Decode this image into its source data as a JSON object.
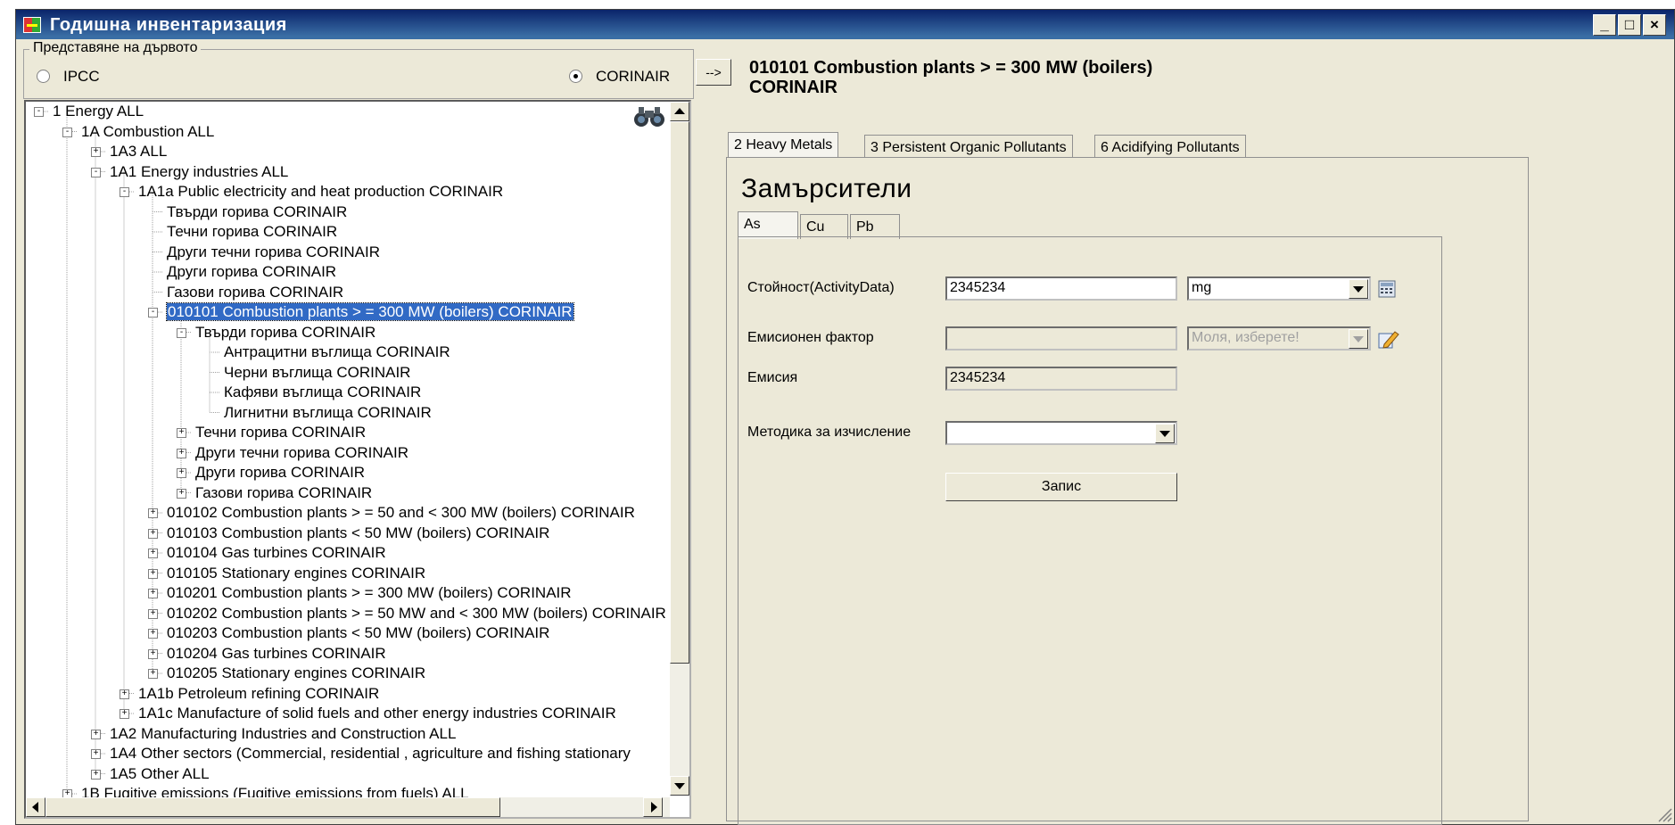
{
  "window": {
    "title": "Годишна инвентаризация",
    "minimize": "_",
    "maximize": "□",
    "close": "×"
  },
  "tree_view": {
    "legend": "Представяне на дървото",
    "option_ipcc": "IPCC",
    "option_corinair": "CORINAIR",
    "selected_option": "CORINAIR"
  },
  "tree": [
    {
      "level": 0,
      "expander": "-",
      "label": "1 Energy  ALL"
    },
    {
      "level": 1,
      "expander": "-",
      "label": "1A Combustion  ALL"
    },
    {
      "level": 2,
      "expander": "+",
      "label": "1A3  ALL"
    },
    {
      "level": 2,
      "expander": "-",
      "label": "1A1 Energy industries  ALL"
    },
    {
      "level": 3,
      "expander": "-",
      "label": "1A1a Public electricity and heat production  CORINAIR"
    },
    {
      "level": 4,
      "expander": "",
      "label": "Твърди горива  CORINAIR"
    },
    {
      "level": 4,
      "expander": "",
      "label": "Течни горива  CORINAIR"
    },
    {
      "level": 4,
      "expander": "",
      "label": "Други течни горива  CORINAIR"
    },
    {
      "level": 4,
      "expander": "",
      "label": "Други горива  CORINAIR"
    },
    {
      "level": 4,
      "expander": "",
      "label": "Газови горива  CORINAIR"
    },
    {
      "level": 4,
      "expander": "-",
      "label": "010101 Combustion plants > = 300 MW (boilers)  CORINAIR",
      "selected": true
    },
    {
      "level": 5,
      "expander": "-",
      "label": "Твърди горива  CORINAIR"
    },
    {
      "level": 6,
      "expander": "",
      "label": "Антрацитни въглища  CORINAIR"
    },
    {
      "level": 6,
      "expander": "",
      "label": "Черни въглища  CORINAIR"
    },
    {
      "level": 6,
      "expander": "",
      "label": "Кафяви въглища  CORINAIR"
    },
    {
      "level": 6,
      "expander": "",
      "label": "Лигнитни въглища  CORINAIR"
    },
    {
      "level": 5,
      "expander": "+",
      "label": "Течни горива  CORINAIR"
    },
    {
      "level": 5,
      "expander": "+",
      "label": "Други течни горива  CORINAIR"
    },
    {
      "level": 5,
      "expander": "+",
      "label": "Други горива  CORINAIR"
    },
    {
      "level": 5,
      "expander": "+",
      "label": "Газови горива  CORINAIR"
    },
    {
      "level": 4,
      "expander": "+",
      "label": "010102 Combustion plants > = 50 and < 300 MW (boilers)  CORINAIR"
    },
    {
      "level": 4,
      "expander": "+",
      "label": "010103 Combustion plants < 50 MW (boilers)  CORINAIR"
    },
    {
      "level": 4,
      "expander": "+",
      "label": "010104 Gas turbines  CORINAIR"
    },
    {
      "level": 4,
      "expander": "+",
      "label": "010105 Stationary engines  CORINAIR"
    },
    {
      "level": 4,
      "expander": "+",
      "label": "010201 Combustion plants > = 300 MW (boilers)  CORINAIR"
    },
    {
      "level": 4,
      "expander": "+",
      "label": "010202 Combustion plants > = 50 MW and < 300 MW (boilers)  CORINAIR"
    },
    {
      "level": 4,
      "expander": "+",
      "label": "010203 Combustion plants < 50 MW (boilers)  CORINAIR"
    },
    {
      "level": 4,
      "expander": "+",
      "label": "010204 Gas turbines  CORINAIR"
    },
    {
      "level": 4,
      "expander": "+",
      "label": "010205 Stationary engines  CORINAIR"
    },
    {
      "level": 3,
      "expander": "+",
      "label": "1A1b Petroleum refining  CORINAIR"
    },
    {
      "level": 3,
      "expander": "+",
      "label": "1A1c Manufacture of solid fuels and other energy industries  CORINAIR"
    },
    {
      "level": 2,
      "expander": "+",
      "label": "1A2 Manufacturing Industries and Construction  ALL"
    },
    {
      "level": 2,
      "expander": "+",
      "label": "1A4 Other sectors (Commercial, residential , agriculture and fishing stationary"
    },
    {
      "level": 2,
      "expander": "+",
      "label": "1A5 Other  ALL"
    },
    {
      "level": 1,
      "expander": "+",
      "label": "1B Fugitive emissions (Fugitive emissions from fuels)  ALL"
    }
  ],
  "detail": {
    "arrow_label": "-->",
    "heading_line1": "010101 Combustion plants > = 300 MW (boilers)",
    "heading_line2": "CORINAIR",
    "tabs": [
      "2 Heavy Metals",
      "3 Persistent Organic Pollutants",
      "6 Acidifying Pollutants"
    ],
    "active_tab": 0,
    "pollutants_title": "Замърсители",
    "subtabs": [
      "As",
      "Cu",
      "Pb"
    ],
    "active_subtab": 0,
    "activity_label": "Стойност(ActivityData)",
    "activity_value": "2345234",
    "unit_value": "mg",
    "factor_label": "Емисионен фактор",
    "factor_value": "",
    "factor_placeholder": "Моля, изберете!",
    "emission_label": "Емисия",
    "emission_value": "2345234",
    "method_label": "Методика за изчисление",
    "method_value": "",
    "save_label": "Запис"
  },
  "colors": {
    "title_bar": "#0a246a",
    "selection": "#316ac5",
    "window_bg": "#ece9d8"
  }
}
